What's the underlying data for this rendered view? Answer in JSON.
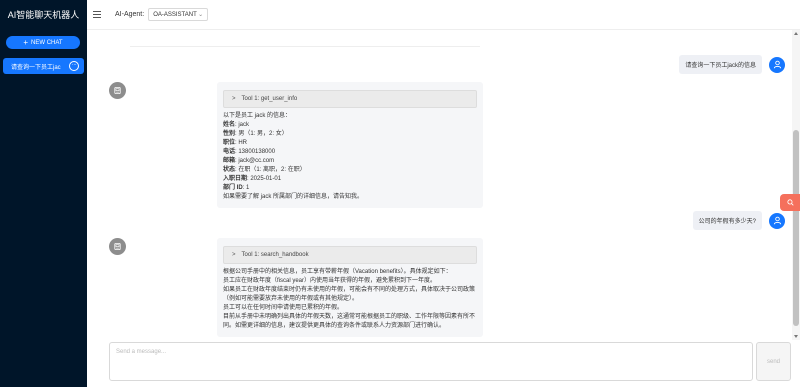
{
  "sidebar": {
    "brand": "AI智能聊天机器人",
    "new_chat_label": "NEW CHAT",
    "conversations": [
      {
        "label": "请查询一下员工jac"
      }
    ]
  },
  "header": {
    "agent_label": "AI-Agent:",
    "agent_value": "OA-ASSISTANT"
  },
  "messages": [
    {
      "role": "user",
      "text": "请查询一下员工jack的信息"
    },
    {
      "role": "assistant",
      "tool": "Tool 1: get_user_info",
      "lines": [
        {
          "label": "",
          "value": "以下是员工 jack 的信息："
        },
        {
          "label": "姓名",
          "value": ": jack"
        },
        {
          "label": "性别",
          "value": ": 男（1: 男，2: 女）"
        },
        {
          "label": "职位",
          "value": ": HR"
        },
        {
          "label": "电话",
          "value": ": 13800138000"
        },
        {
          "label": "邮箱",
          "value": ": jack@cc.com"
        },
        {
          "label": "状态",
          "value": ": 在职（1: 离职，2: 在职）"
        },
        {
          "label": "入职日期",
          "value": ": 2025-01-01"
        },
        {
          "label": "部门 ID",
          "value": ": 1"
        },
        {
          "label": "",
          "value": "如果需要了解 jack 所属部门的详细信息，请告知我。"
        }
      ]
    },
    {
      "role": "user",
      "text": "公司的年假有多少天?"
    },
    {
      "role": "assistant",
      "tool": "Tool 1: search_handbook",
      "lines": [
        {
          "label": "",
          "value": "根据公司手册中的相关信息，员工享有带薪年假（Vacation benefits）。具体规定如下："
        },
        {
          "label": "",
          "value": "员工应在财政年度（fiscal year）内使用当年获得的年假，避免累积到下一年度。"
        },
        {
          "label": "",
          "value": "如果员工在财政年度结束时仍有未使用的年假，可能会有不同的处理方式，具体取决于公司政策"
        },
        {
          "label": "",
          "value": "（例如可能需要放弃未使用的年假或有其他规定）。"
        },
        {
          "label": "",
          "value": "员工可以在任何时间申请使用已累积的年假。"
        },
        {
          "label": "",
          "value": "目前从手册中未明确列出具体的年假天数，这通常可能根据员工的职级、工作年限等因素有所不"
        },
        {
          "label": "",
          "value": "同。如需更详细的信息，建议提供更具体的查询条件或联系人力资源部门进行确认。"
        }
      ]
    }
  ],
  "input": {
    "placeholder": "Send a message...",
    "send_label": "send"
  },
  "colors": {
    "sidebar_bg": "#001529",
    "accent": "#1677ff",
    "float_button": "#f5705c"
  },
  "icons": {
    "menu": "menu-icon",
    "plus": "plus-icon",
    "more": "more-icon",
    "user_avatar": "user-icon",
    "bot_avatar": "robot-icon",
    "chevron": "chevron-right-icon",
    "float": "search-icon"
  }
}
